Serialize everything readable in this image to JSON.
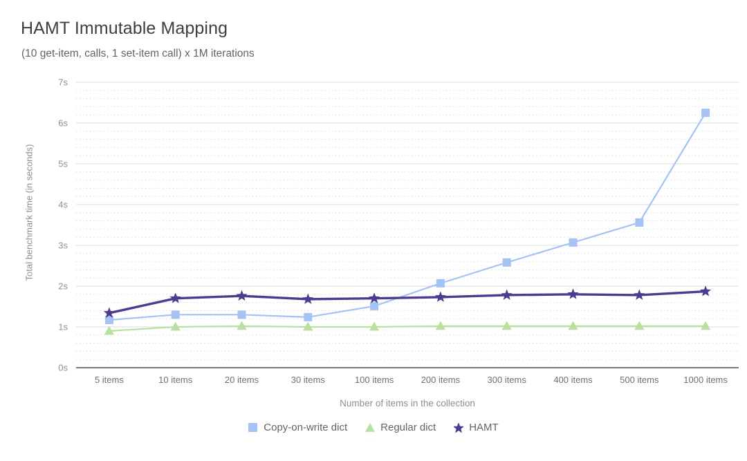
{
  "chart_data": {
    "type": "line",
    "title": "HAMT Immutable Mapping",
    "subtitle": "(10 get-item, calls, 1 set-item call) x 1M iterations",
    "xlabel": "Number of items in the collection",
    "ylabel": "Total benchmark time (in seconds)",
    "categories": [
      "5 items",
      "10 items",
      "20 items",
      "30 items",
      "100 items",
      "200 items",
      "300 items",
      "400 items",
      "500 items",
      "1000 items"
    ],
    "ylim": [
      0,
      7
    ],
    "y_ticks": [
      "0s",
      "1s",
      "2s",
      "3s",
      "4s",
      "5s",
      "6s",
      "7s"
    ],
    "y_tick_values": [
      0,
      1,
      2,
      3,
      4,
      5,
      6,
      7
    ],
    "y_minor_step": 0.2,
    "grid": true,
    "legend_position": "bottom",
    "series": [
      {
        "name": "Copy-on-write dict",
        "color": "#a4c2f4",
        "marker": "square",
        "values": [
          1.17,
          1.3,
          1.3,
          1.24,
          1.51,
          2.07,
          2.58,
          3.07,
          3.56,
          6.25
        ]
      },
      {
        "name": "Regular dict",
        "color": "#b7e1a1",
        "marker": "triangle",
        "values": [
          0.9,
          1.0,
          1.02,
          1.0,
          1.0,
          1.02,
          1.02,
          1.02,
          1.02,
          1.02
        ]
      },
      {
        "name": "HAMT",
        "color": "#4e3a91",
        "marker": "star",
        "values": [
          1.34,
          1.7,
          1.76,
          1.68,
          1.7,
          1.73,
          1.78,
          1.8,
          1.78,
          1.87
        ]
      }
    ]
  },
  "legend": {
    "items": [
      {
        "label": "Copy-on-write dict",
        "icon": "square-marker-icon"
      },
      {
        "label": "Regular dict",
        "icon": "triangle-marker-icon"
      },
      {
        "label": "HAMT",
        "icon": "star-marker-icon"
      }
    ]
  },
  "colors": {
    "copy_on_write": "#a4c2f4",
    "regular_dict": "#b7e1a1",
    "hamt": "#4e3a91",
    "grid_major": "#d8d8d8",
    "grid_minor": "#dcdcdc",
    "axis": "#555a5e",
    "text": "#8a8f94"
  }
}
